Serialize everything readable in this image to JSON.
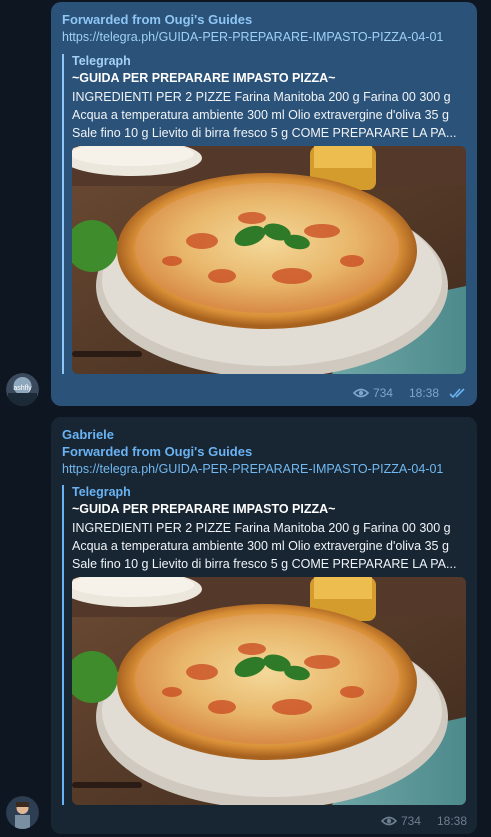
{
  "messages": [
    {
      "sender": "",
      "forwarded": "Forwarded from Ougi's Guides",
      "url": "https://telegra.ph/GUIDA-PER-PREPARARE-IMPASTO-PIZZA-04-01",
      "preview": {
        "site": "Telegraph",
        "title": "~GUIDA PER PREPARARE IMPASTO PIZZA~",
        "description": "INGREDIENTI PER 2 PIZZE Farina Manitoba 200 g Farina 00 300 g Acqua a temperatura ambiente 300 ml Olio extravergine d'oliva 35 g Sale fino 10 g Lievito di birra fresco 5 g COME PREPARARE LA PA..."
      },
      "views": "734",
      "time": "18:38",
      "avatar_label": "ashfly"
    },
    {
      "sender": "Gabriele",
      "forwarded": "Forwarded from Ougi's Guides",
      "url": "https://telegra.ph/GUIDA-PER-PREPARARE-IMPASTO-PIZZA-04-01",
      "preview": {
        "site": "Telegraph",
        "title": "~GUIDA PER PREPARARE IMPASTO PIZZA~",
        "description": "INGREDIENTI PER 2 PIZZE Farina Manitoba 200 g Farina 00 300 g Acqua a temperatura ambiente 300 ml Olio extravergine d'oliva 35 g Sale fino 10 g Lievito di birra fresco 5 g COME PREPARARE LA PA..."
      },
      "views": "734",
      "time": "18:38"
    }
  ],
  "icons": {
    "views": "eye-icon",
    "read": "double-check-icon"
  },
  "colors": {
    "outgoing_bubble": "#2b5278",
    "incoming_bubble": "#182533",
    "accent": "#6ab3f3",
    "background": "#0e1621"
  }
}
